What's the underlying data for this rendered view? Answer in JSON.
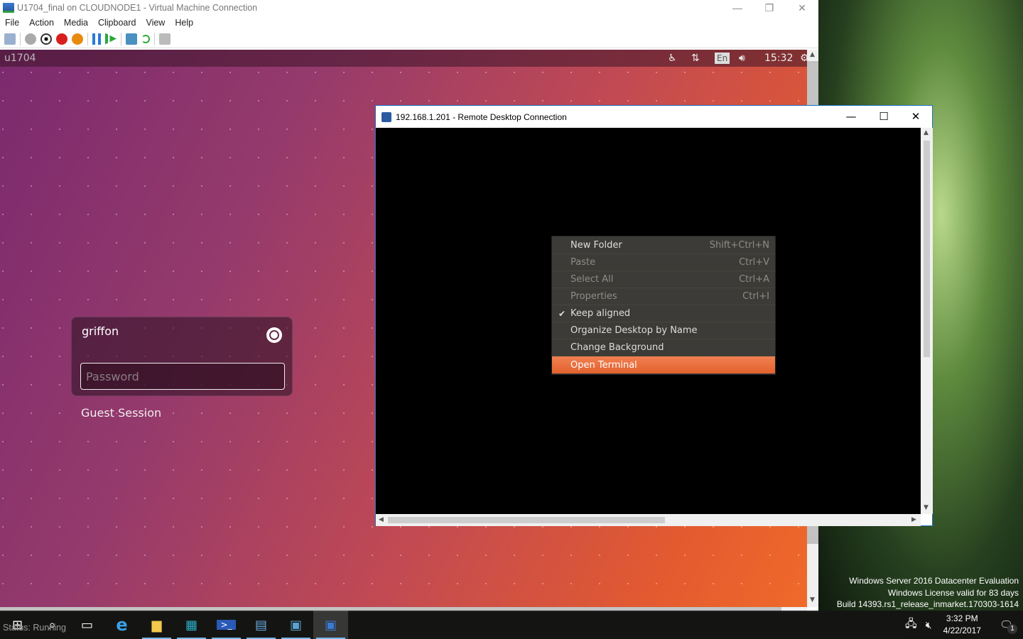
{
  "vm_window": {
    "title": "U1704_final on CLOUDNODE1 - Virtual Machine Connection",
    "menu": [
      "File",
      "Action",
      "Media",
      "Clipboard",
      "View",
      "Help"
    ],
    "toolbar": [
      "ctrl-alt-del-icon",
      "start-icon",
      "turn-off-icon",
      "shutdown-icon",
      "save-icon",
      "pause-icon",
      "resume-icon",
      "checkpoint-icon",
      "revert-icon",
      "enhanced-session-icon"
    ],
    "status": "Status: Running"
  },
  "ubuntu": {
    "hostname": "u1704",
    "panel": {
      "keyboard": "En",
      "time": "15:32"
    },
    "login": {
      "username": "griffon",
      "password_placeholder": "Password",
      "guest": "Guest Session"
    }
  },
  "rdp": {
    "title": "192.168.1.201 - Remote Desktop Connection",
    "context_menu": [
      {
        "label": "New Folder",
        "shortcut": "Shift+Ctrl+N",
        "enabled": true
      },
      {
        "label": "Paste",
        "shortcut": "Ctrl+V",
        "enabled": false
      },
      {
        "label": "Select All",
        "shortcut": "Ctrl+A",
        "enabled": false
      },
      {
        "label": "Properties",
        "shortcut": "Ctrl+I",
        "enabled": false
      },
      {
        "label": "Keep aligned",
        "checked": true,
        "enabled": true
      },
      {
        "label": "Organize Desktop by Name",
        "enabled": true
      },
      {
        "label": "Change Background",
        "enabled": true
      },
      {
        "label": "Open Terminal",
        "enabled": true,
        "highlighted": true
      }
    ]
  },
  "watermark": [
    "Windows Server 2016 Datacenter Evaluation",
    "Windows License valid for 83 days",
    "Build 14393.rs1_release_inmarket.170303-1614"
  ],
  "taskbar": {
    "time": "3:32 PM",
    "date": "4/22/2017",
    "notifications": "1",
    "apps": [
      "start",
      "search",
      "task-view",
      "internet-explorer",
      "file-explorer",
      "server-manager",
      "powershell",
      "hyperv-manager",
      "vm-connection",
      "remote-desktop"
    ]
  },
  "colors": {
    "accent_orange": "#e9642f",
    "ubuntu_purple": "#7b2a6e",
    "rdp_border": "#1a73c9"
  }
}
